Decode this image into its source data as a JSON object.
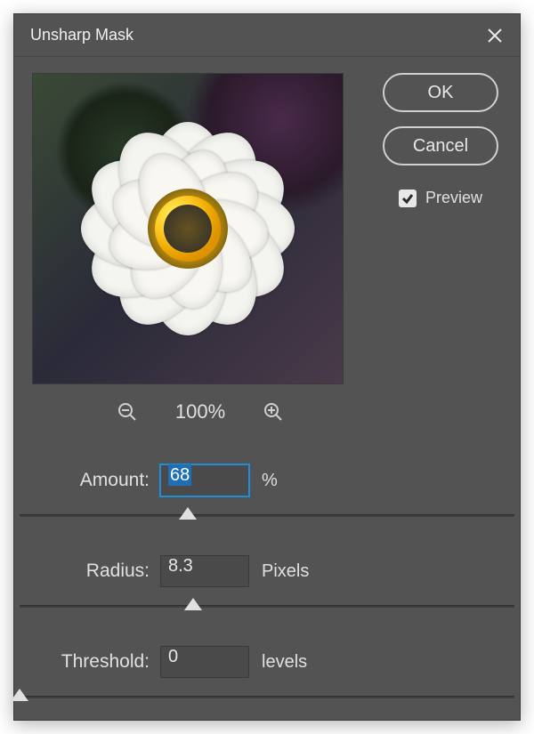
{
  "dialog": {
    "title": "Unsharp Mask",
    "buttons": {
      "ok": "OK",
      "cancel": "Cancel"
    },
    "preview_checkbox": {
      "label": "Preview",
      "checked": true
    }
  },
  "zoom": {
    "level": "100%"
  },
  "controls": {
    "amount": {
      "label": "Amount:",
      "value": "68",
      "unit": "%",
      "slider_percent": 34
    },
    "radius": {
      "label": "Radius:",
      "value": "8.3",
      "unit": "Pixels",
      "slider_percent": 35
    },
    "threshold": {
      "label": "Threshold:",
      "value": "0",
      "unit": "levels",
      "slider_percent": 0
    }
  }
}
